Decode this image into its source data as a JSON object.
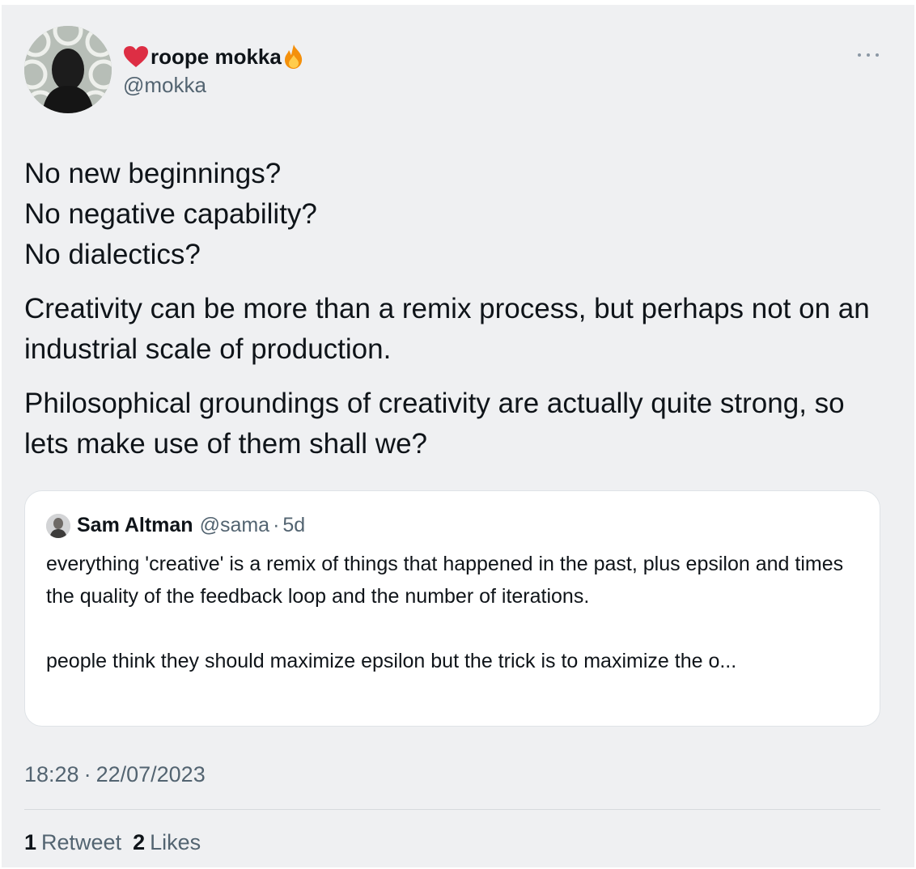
{
  "author": {
    "name": "roope mokka",
    "handle": "@mokka",
    "name_prefix_emoji": "heart-icon",
    "name_suffix_emoji": "fire-icon"
  },
  "tweet": {
    "paragraphs": [
      "No new beginnings?\nNo negative capability?\nNo dialectics?",
      "Creativity can be more than a remix process, but perhaps not on an industrial scale of production.",
      "Philosophical groundings of creativity are actually quite strong, so lets make use of them shall we?"
    ]
  },
  "quote": {
    "name": "Sam Altman",
    "handle": "@sama",
    "separator": "·",
    "time": "5d",
    "text": "everything 'creative' is a remix of things that happened in the past, plus epsilon and times the quality of the feedback loop and the number of iterations.\n\npeople think they should maximize epsilon but the trick is to maximize the o..."
  },
  "meta": {
    "time": "18:28",
    "separator": "·",
    "date": "22/07/2023"
  },
  "stats": {
    "retweets_count": "1",
    "retweets_label": "Retweet",
    "likes_count": "2",
    "likes_label": "Likes"
  },
  "colors": {
    "background": "#eff0f2",
    "text_primary": "#0f1419",
    "text_secondary": "#536471",
    "quote_background": "#ffffff"
  }
}
